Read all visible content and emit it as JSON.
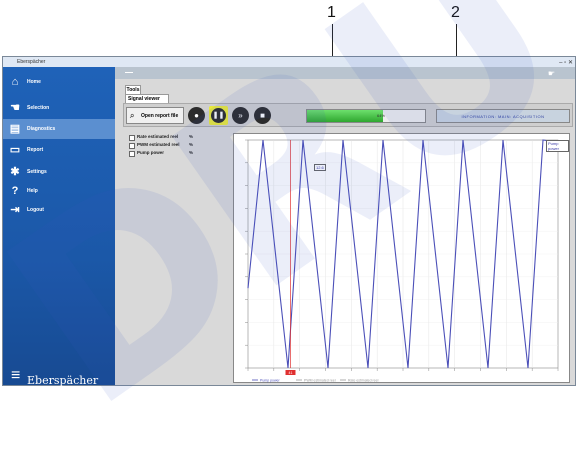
{
  "callouts": [
    "1",
    "2"
  ],
  "watermark": "DRU",
  "window": {
    "title": "Eberspächer",
    "buttons": "– ▫ ✕"
  },
  "sidebar": {
    "items": [
      {
        "label": "Home",
        "icon": "home-icon",
        "glyph": "⌂"
      },
      {
        "label": "Selection",
        "icon": "hand-icon",
        "glyph": "☚"
      },
      {
        "label": "Diagnostics",
        "icon": "diagnostics-icon",
        "glyph": "▤"
      },
      {
        "label": "Report",
        "icon": "report-icon",
        "glyph": "▭"
      },
      {
        "label": "Settings",
        "icon": "gear-icon",
        "glyph": "✱"
      },
      {
        "label": "Help",
        "icon": "help-icon",
        "glyph": "?"
      },
      {
        "label": "Logout",
        "icon": "logout-icon",
        "glyph": "⇥"
      }
    ],
    "active_index": 2,
    "logo_text": "Eberspächer"
  },
  "tabs": {
    "tools": "Tools",
    "signal_viewer": "Signal viewer"
  },
  "toolbar": {
    "open_label": "Open report file",
    "progress_text": "64%",
    "progress_fraction": 0.64,
    "status_text": "INFORMATION: MAIN: ACQUISITION"
  },
  "signals": [
    {
      "name": "Rate estimated reel",
      "unit": "%"
    },
    {
      "name": "PWM estimated reel",
      "unit": "%"
    },
    {
      "name": "Pump power",
      "unit": "%"
    }
  ],
  "chart_data": {
    "type": "line",
    "title": "",
    "legend": [
      "Pump power",
      "PWM estimated reel",
      "Rate estimated reel"
    ],
    "corner_label": "Pump power",
    "marker_label": "41",
    "cursor_label": "12.6",
    "series": [
      {
        "name": "Pump power",
        "color": "#4b4fb8",
        "x": [
          0,
          3,
          8,
          11,
          16,
          19,
          24,
          27,
          32,
          35,
          40,
          43,
          48,
          51,
          56,
          59,
          62
        ],
        "y": [
          35,
          100,
          0,
          100,
          0,
          100,
          0,
          100,
          0,
          100,
          0,
          100,
          0,
          100,
          0,
          100,
          99
        ]
      }
    ],
    "xlim": [
      0,
      62
    ],
    "ylim": [
      0,
      100
    ]
  },
  "colors": {
    "sidebar": "#1f62b8",
    "accent": "#eaea3a",
    "progress": "#2fa72f",
    "line": "#4b4fb8",
    "cursor": "#e03030"
  }
}
